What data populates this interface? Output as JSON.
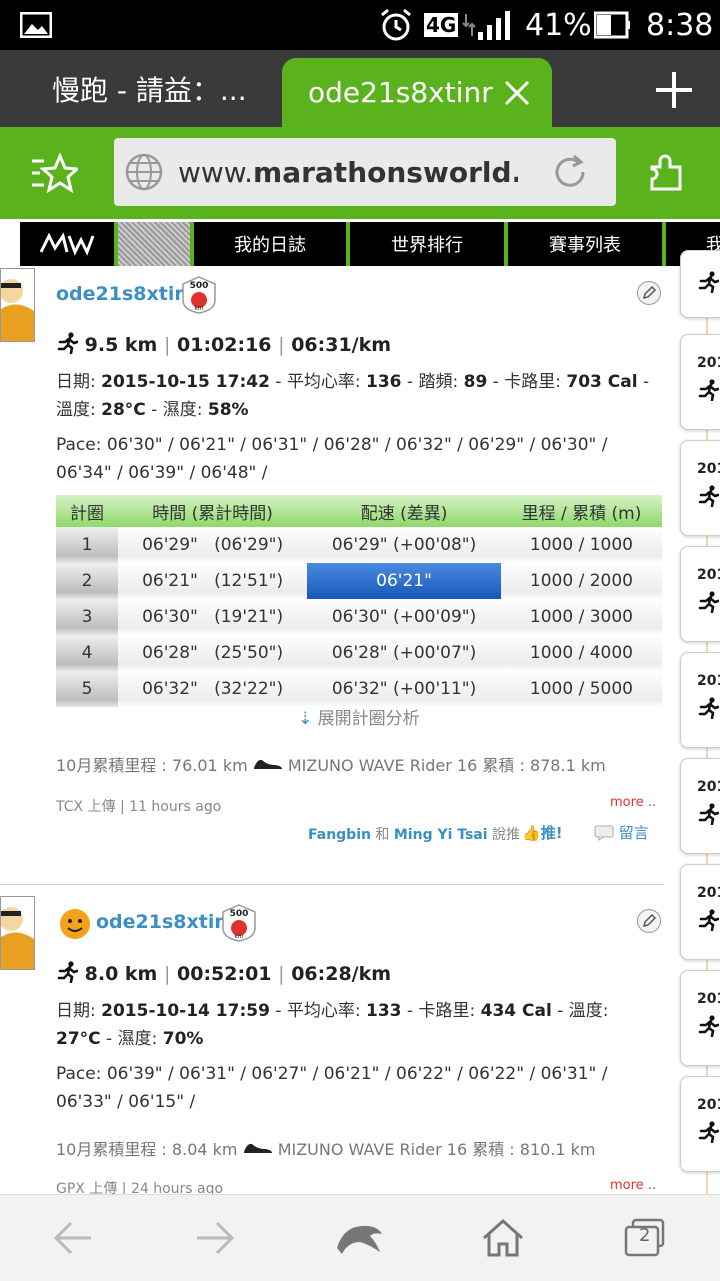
{
  "status_bar": {
    "network": "4G",
    "battery": "41%",
    "time": "8:38"
  },
  "tabs": [
    {
      "label": "慢跑 - 請益：..."
    },
    {
      "label": "ode21s8xtinr"
    }
  ],
  "url": {
    "prefix": "www.",
    "domain": "marathonsworld",
    "suffix": "...."
  },
  "site_nav": {
    "items": [
      "我的日誌",
      "世界排行",
      "賽事列表",
      "我"
    ]
  },
  "posts": [
    {
      "username": "ode21s8xtinr",
      "badge": "500",
      "badge_unit": "km",
      "distance": "9.5 km",
      "duration": "01:02:16",
      "pace": "06:31/km",
      "date_label": "日期:",
      "date": "2015-10-15 17:42",
      "hr_label": "平均心率:",
      "hr": "136",
      "cadence_label": "踏頻:",
      "cadence": "89",
      "cal_label": "卡路里:",
      "cal": "703 Cal",
      "temp_label": "溫度:",
      "temp": "28°C",
      "humidity_label": "濕度:",
      "humidity": "58%",
      "pace_splits": "Pace: 06'30\" / 06'21\" / 06'31\" / 06'28\" / 06'32\" / 06'29\" / 06'30\" / 06'34\" / 06'39\" / 06'48\" /",
      "expand_label": "展開計圈分析",
      "monthly": "10月累積里程 : 76.01 km",
      "shoe": "MIZUNO WAVE Rider 16 累積 : 878.1 km",
      "upload": "TCX 上傳 | 11 hours ago",
      "more": "more ..",
      "likes_user1": "Fangbin",
      "likes_and": "和",
      "likes_user2": "Ming Yi Tsai",
      "likes_suffix": "說推 ·",
      "push_label": "推!",
      "comment_label": "留言"
    },
    {
      "username": "ode21s8xtinr",
      "badge": "500",
      "badge_unit": "km",
      "distance": "8.0 km",
      "duration": "00:52:01",
      "pace": "06:28/km",
      "date_label": "日期:",
      "date": "2015-10-14 17:59",
      "hr_label": "平均心率:",
      "hr": "133",
      "cal_label": "卡路里:",
      "cal": "434 Cal",
      "temp_label": "溫度:",
      "temp": "27°C",
      "humidity_label": "濕度:",
      "humidity": "70%",
      "pace_splits": "Pace: 06'39\" / 06'31\" / 06'27\" / 06'21\" / 06'22\" / 06'22\" / 06'31\" / 06'33\" / 06'15\" /",
      "monthly": "10月累積里程 : 8.04 km",
      "shoe": "MIZUNO WAVE Rider 16 累積 : 810.1 km",
      "upload": "GPX 上傳 | 24 hours ago",
      "more": "more .."
    }
  ],
  "lap_table": {
    "headers": [
      "計圈",
      "時間 (累計時間)",
      "配速 (差異)",
      "里程 / 累積 (m)"
    ],
    "rows": [
      {
        "lap": "1",
        "time": "06'29\"",
        "cum": "(06'29\")",
        "pace": "06'29\" (+00'08\")",
        "dist": "1000 / 1000"
      },
      {
        "lap": "2",
        "time": "06'21\"",
        "cum": "(12'51\")",
        "pace": "06'21\"",
        "dist": "1000 / 2000"
      },
      {
        "lap": "3",
        "time": "06'30\"",
        "cum": "(19'21\")",
        "pace": "06'30\" (+00'09\")",
        "dist": "1000 / 3000"
      },
      {
        "lap": "4",
        "time": "06'28\"",
        "cum": "(25'50\")",
        "pace": "06'28\" (+00'07\")",
        "dist": "1000 / 4000"
      },
      {
        "lap": "5",
        "time": "06'32\"",
        "cum": "(32'22\")",
        "pace": "06'32\" (+00'11\")",
        "dist": "1000 / 5000"
      }
    ]
  },
  "right_strip": {
    "year_label": "201"
  },
  "toolbar": {
    "tab_count": "2"
  },
  "colors": {
    "accent": "#5ab31c",
    "link": "#3b8fc5",
    "highlight": "#1558b8",
    "more": "#e0322c"
  }
}
